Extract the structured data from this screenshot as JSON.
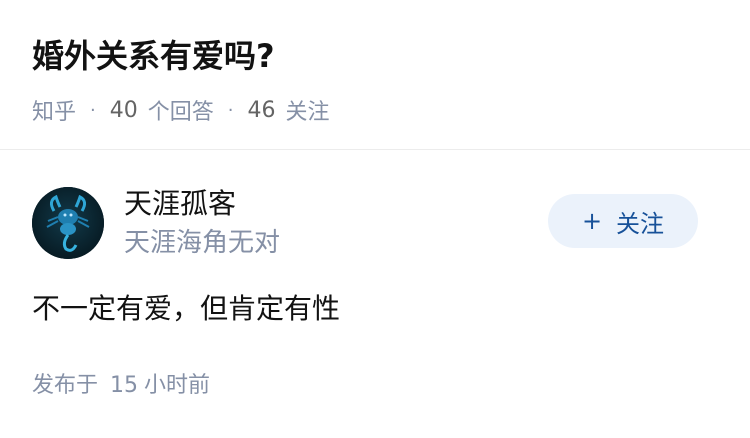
{
  "question": {
    "title": "婚外关系有爱吗?",
    "meta": {
      "source": "知乎",
      "answers_count": "40",
      "answers_label": "个回答",
      "followers_count": "46",
      "followers_label": "关注",
      "separator": "·"
    }
  },
  "answer": {
    "author": {
      "name": "天涯孤客",
      "bio": "天涯海角无对",
      "avatar_icon": "scorpion-icon"
    },
    "follow_button": {
      "icon": "+",
      "label": "关注"
    },
    "content": "不一定有爱，但肯定有性",
    "publish": {
      "prefix": "发布于",
      "time_value": "15",
      "time_unit": "小时前"
    }
  },
  "colors": {
    "accent": "#175199",
    "follow_bg": "#ebf2fb",
    "meta_text": "#8590a6",
    "title_text": "#121212"
  }
}
